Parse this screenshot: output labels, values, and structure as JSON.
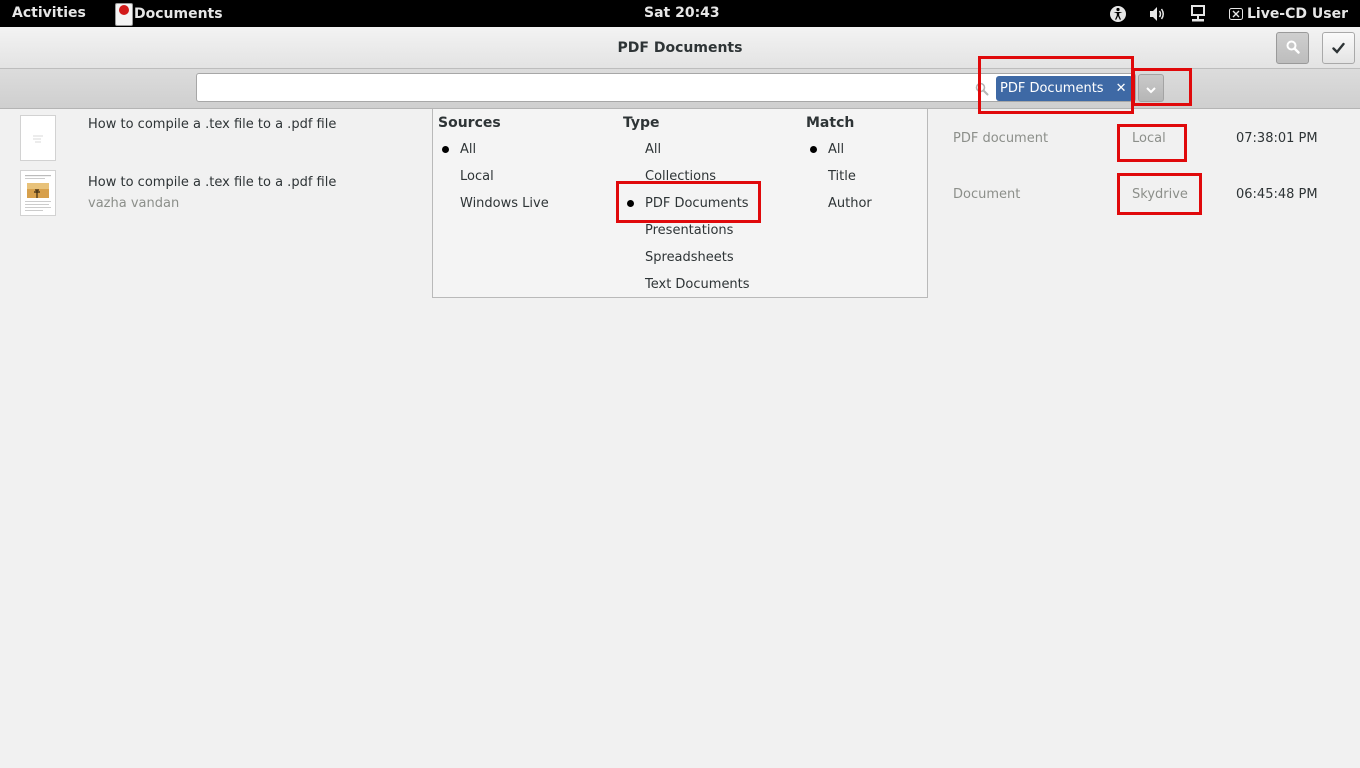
{
  "topbar": {
    "activities": "Activities",
    "app_name": "Documents",
    "clock": "Sat 20:43",
    "user": "Live-CD User",
    "icons": [
      "accessibility-icon",
      "volume-icon",
      "network-icon",
      "user-icon"
    ]
  },
  "window": {
    "title": "PDF Documents",
    "search_button_icon": "search-icon",
    "select_button_icon": "checkmark-icon"
  },
  "search": {
    "value": "",
    "placeholder": "",
    "tag_label": "PDF Documents",
    "tag_close": "✕",
    "dropdown_icon": "chevron-down-icon"
  },
  "documents": [
    {
      "title": "How to compile a .tex file to a .pdf file",
      "author": "",
      "type": "",
      "source": "",
      "time": ""
    },
    {
      "title": "How to compile a .tex file to a .pdf file",
      "author": "vazha vandan",
      "type": "",
      "source": "",
      "time": ""
    }
  ],
  "details": [
    {
      "type": "PDF document",
      "source": "Local",
      "time": "07:38:01 PM"
    },
    {
      "type": "Document",
      "source": "Skydrive",
      "time": "06:45:48 PM"
    }
  ],
  "filters": {
    "sources": {
      "heading": "Sources",
      "options": [
        "All",
        "Local",
        "Windows Live"
      ],
      "selected": "All"
    },
    "type": {
      "heading": "Type",
      "options": [
        "All",
        "Collections",
        "PDF Documents",
        "Presentations",
        "Spreadsheets",
        "Text Documents"
      ],
      "selected": "PDF Documents"
    },
    "match": {
      "heading": "Match",
      "options": [
        "All",
        "Title",
        "Author"
      ],
      "selected": "All"
    }
  },
  "colors": {
    "highlight": "#e0090b",
    "tag": "#3e69a5"
  }
}
